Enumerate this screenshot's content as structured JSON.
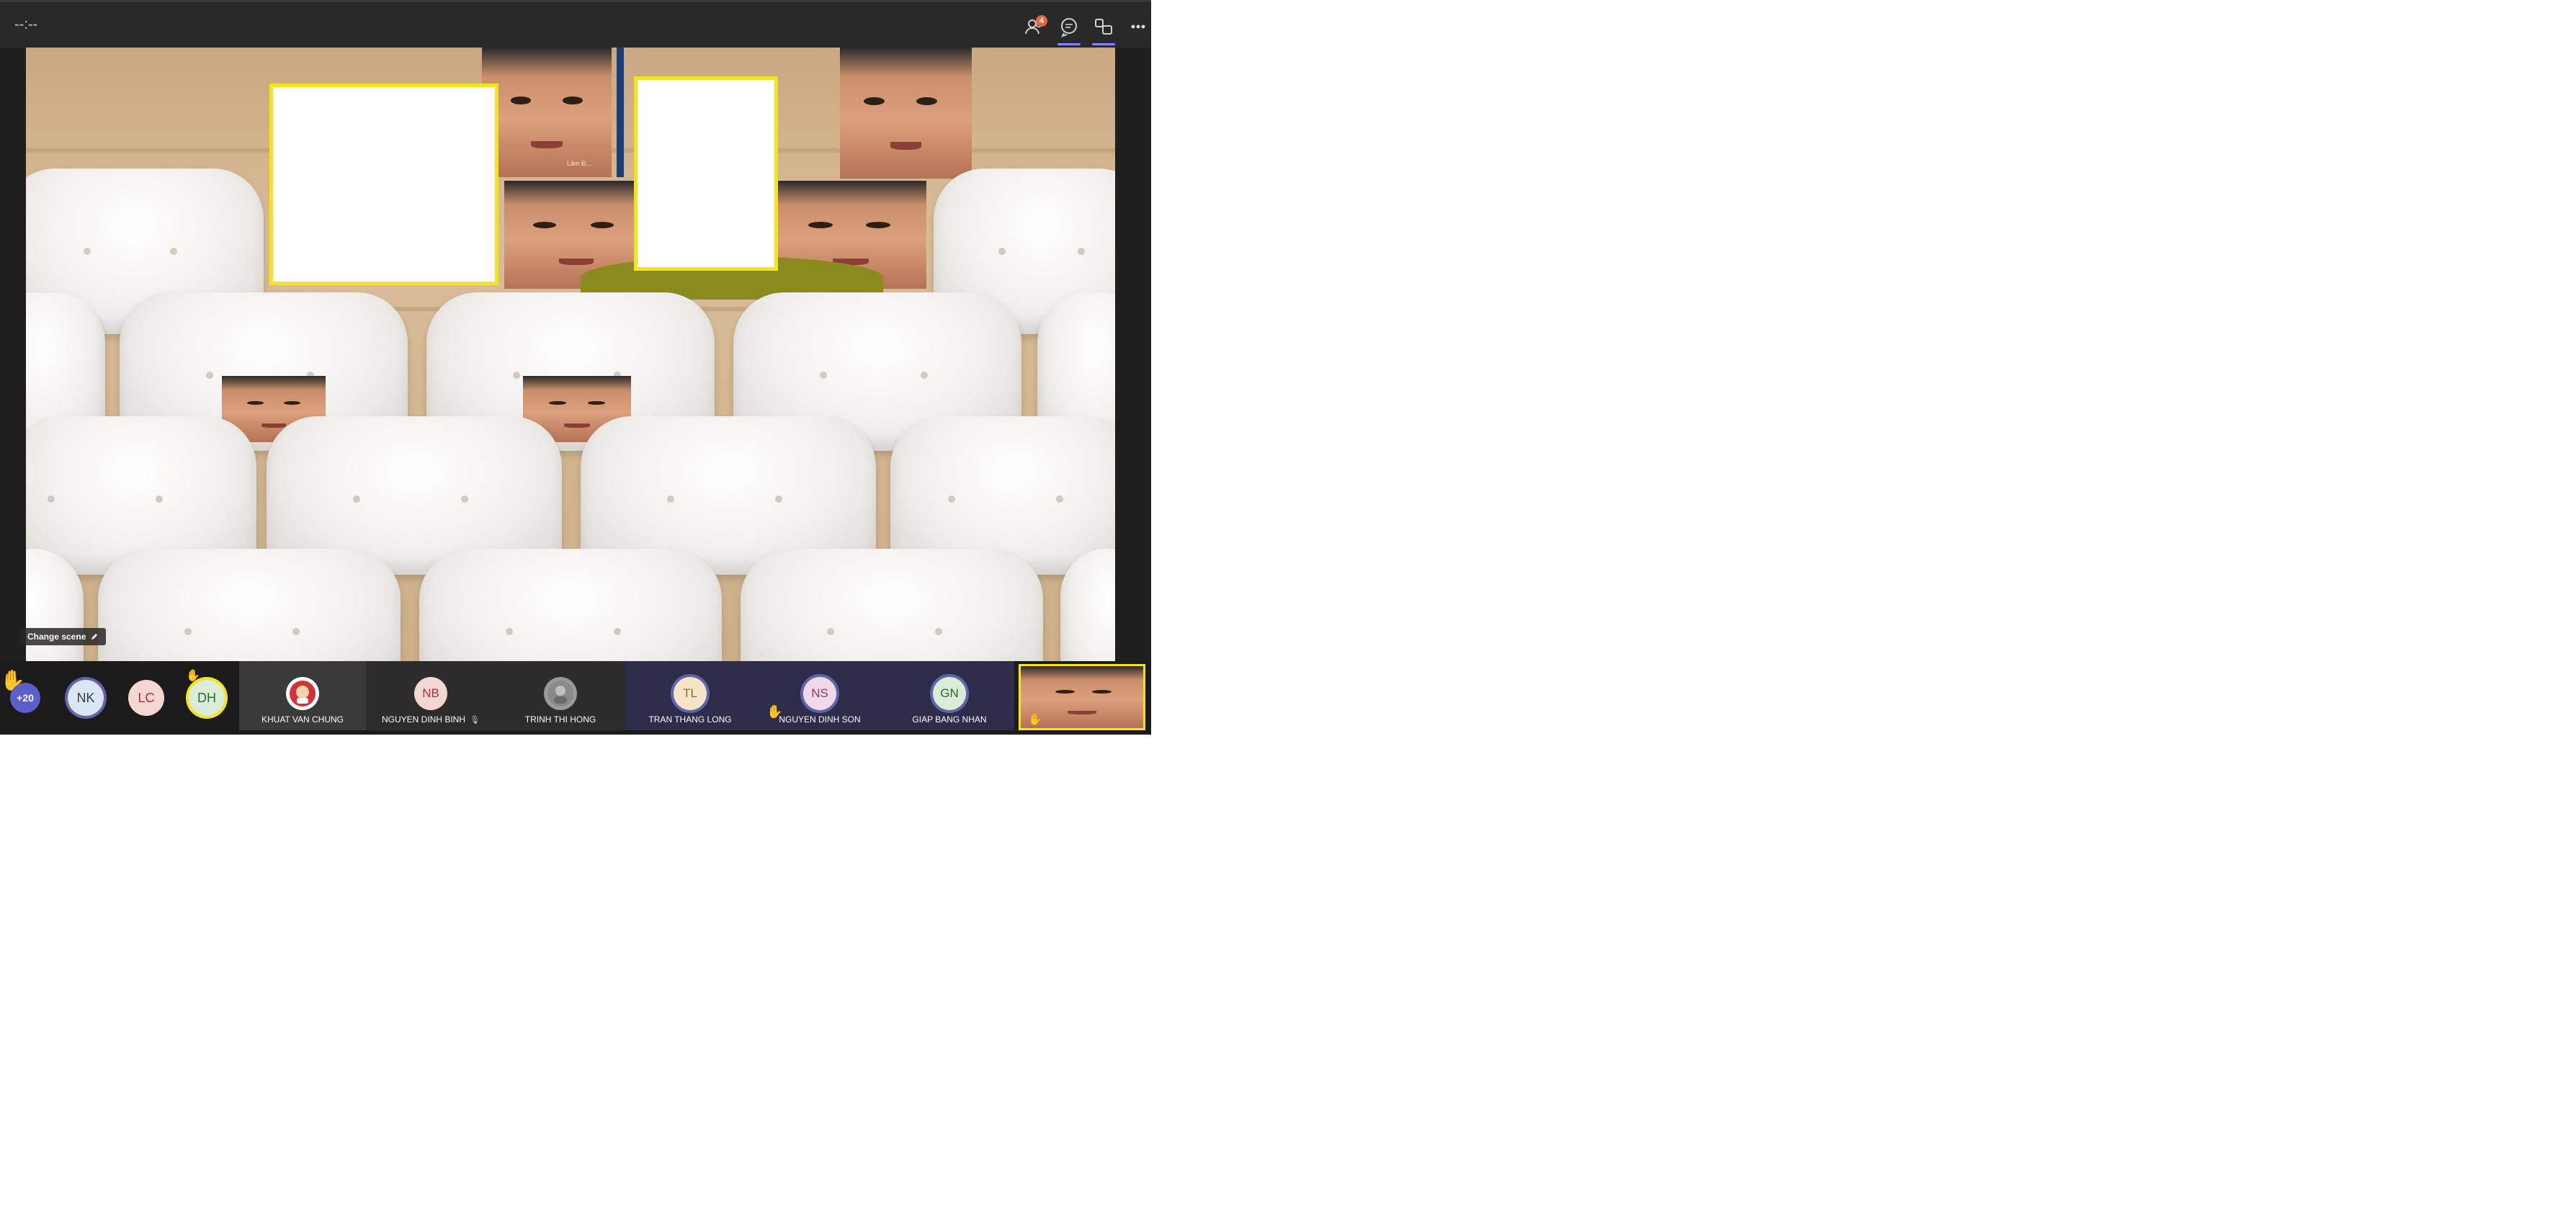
{
  "topbar": {
    "timer": "--:--",
    "participants_badge": "4",
    "actions": [
      {
        "name": "participants",
        "icon": "people-icon"
      },
      {
        "name": "chat",
        "icon": "chat-icon"
      },
      {
        "name": "rooms",
        "icon": "rooms-icon"
      },
      {
        "name": "more",
        "icon": "ellipsis-icon"
      }
    ]
  },
  "stage": {
    "change_scene_label": "Change scene",
    "tile_label_small": "Lâm Đ..."
  },
  "strip": {
    "overflow_count": "+20",
    "mini_avatars": [
      {
        "initials": "NK",
        "color": "#dbe6f4",
        "ring": "purple"
      },
      {
        "initials": "LC",
        "color": "#f4d6d2",
        "ring": "none"
      },
      {
        "initials": "DH",
        "color": "#d8ecd8",
        "ring": "yellow"
      }
    ],
    "tiles": [
      {
        "name": "KHUAT VAN CHUNG",
        "initials": "",
        "bg": "#3a3a3a",
        "avatar_color": "#d13438",
        "mic": false,
        "hand": false
      },
      {
        "name": "NGUYEN DINH BINH",
        "initials": "NB",
        "bg": "#2c2c2c",
        "avatar_color": "#f4d6d2",
        "mic": true,
        "hand": false
      },
      {
        "name": "TRINH THI HONG",
        "initials": "",
        "bg": "#2c2c2c",
        "avatar_color": "#9a9a9a",
        "mic": false,
        "hand": false
      },
      {
        "name": "TRAN THANG LONG",
        "initials": "TL",
        "bg": "#2b2d4a",
        "avatar_color": "#f6e4c6",
        "mic": false,
        "hand": false
      },
      {
        "name": "NGUYEN DINH SON",
        "initials": "NS",
        "bg": "#2b2d4a",
        "avatar_color": "#f1d8e6",
        "mic": false,
        "hand": true
      },
      {
        "name": "GIAP BANG NHAN",
        "initials": "GN",
        "bg": "#2b2d4a",
        "avatar_color": "#d8ecd8",
        "mic": false,
        "hand": false
      }
    ]
  }
}
